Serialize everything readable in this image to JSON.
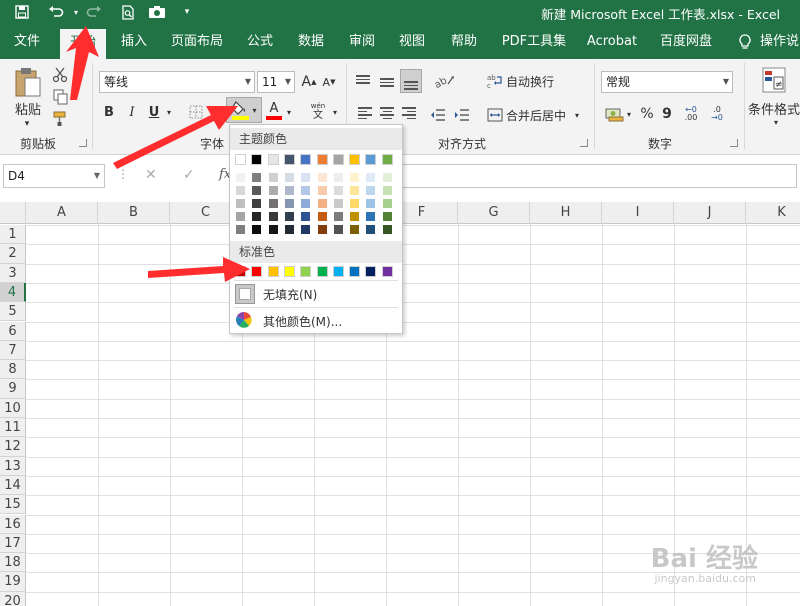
{
  "window": {
    "title": "新建 Microsoft Excel 工作表.xlsx  -  Excel"
  },
  "quick_access": [
    "save-icon",
    "undo-icon",
    "redo-icon",
    "print-preview-icon",
    "camera-icon",
    "customize-icon"
  ],
  "tabs": [
    {
      "label": "文件"
    },
    {
      "label": "开始"
    },
    {
      "label": "插入"
    },
    {
      "label": "页面布局"
    },
    {
      "label": "公式"
    },
    {
      "label": "数据"
    },
    {
      "label": "审阅"
    },
    {
      "label": "视图"
    },
    {
      "label": "帮助"
    },
    {
      "label": "PDF工具集"
    },
    {
      "label": "Acrobat"
    },
    {
      "label": "百度网盘"
    },
    {
      "label": "操作说"
    }
  ],
  "ribbon": {
    "clipboard": {
      "paste": "粘贴",
      "group": "剪贴板"
    },
    "font": {
      "name": "等线",
      "size": "11",
      "bold": "B",
      "italic": "I",
      "underline": "U",
      "font_color_letter": "A",
      "phonetic_top": "wén",
      "phonetic_bottom": "文",
      "grow": "A",
      "shrink": "A",
      "group": "字体"
    },
    "alignment": {
      "wrap": "自动换行",
      "merge": "合并后居中",
      "group": "对齐方式"
    },
    "number": {
      "format": "常规",
      "percent": "%",
      "comma": "9",
      "inc": ".00",
      "dec": ".0",
      "group": "数字"
    },
    "styles": {
      "conditional": "条件格式"
    }
  },
  "formula_bar": {
    "name_box": "D4",
    "cancel": "✕",
    "enter": "✓",
    "fx": "fx"
  },
  "columns": [
    "A",
    "B",
    "C",
    "D",
    "E",
    "F",
    "G",
    "H",
    "I",
    "J",
    "K"
  ],
  "rows": [
    "1",
    "2",
    "3",
    "4",
    "5",
    "6",
    "7",
    "8",
    "9",
    "10",
    "11",
    "12",
    "13",
    "14",
    "15",
    "16",
    "17",
    "18",
    "19",
    "20"
  ],
  "selected_row": "4",
  "color_picker": {
    "theme_title": "主题颜色",
    "standard_title": "标准色",
    "no_fill": "无填充(N)",
    "more_colors": "其他颜色(M)...",
    "theme_base": [
      "#FFFFFF",
      "#000000",
      "#E7E6E6",
      "#44546A",
      "#4472C4",
      "#ED7D31",
      "#A5A5A5",
      "#FFC000",
      "#5B9BD5",
      "#70AD47"
    ],
    "theme_shades": [
      [
        "#F2F2F2",
        "#7F7F7F",
        "#D0CECE",
        "#D6DCE4",
        "#D9E2F3",
        "#FBE5D5",
        "#EDEDED",
        "#FFF2CC",
        "#DEEBF6",
        "#E2EFD9"
      ],
      [
        "#D8D8D8",
        "#595959",
        "#AEABAB",
        "#ADB9CA",
        "#B4C6E7",
        "#F7CBAC",
        "#DBDBDB",
        "#FFE598",
        "#BDD7EE",
        "#C5E0B3"
      ],
      [
        "#BFBFBF",
        "#3F3F3F",
        "#757070",
        "#8496B0",
        "#8EAADB",
        "#F4B183",
        "#C9C9C9",
        "#FFD965",
        "#9CC3E5",
        "#A8D08D"
      ],
      [
        "#A5A5A5",
        "#262626",
        "#3A3838",
        "#323F4F",
        "#2F5496",
        "#C55A11",
        "#7B7B7B",
        "#BF9000",
        "#2E75B5",
        "#538135"
      ],
      [
        "#7F7F7F",
        "#0C0C0C",
        "#171616",
        "#222A35",
        "#1F3864",
        "#833C0B",
        "#525252",
        "#7F6000",
        "#1E4E79",
        "#375623"
      ]
    ],
    "standard": [
      "#C00000",
      "#FF0000",
      "#FFC000",
      "#FFFF00",
      "#92D050",
      "#00B050",
      "#00B0F0",
      "#0070C0",
      "#002060",
      "#7030A0"
    ]
  },
  "watermark": {
    "main": "Bai 经验",
    "sub": "jingyan.baidu.com"
  },
  "colors": {
    "excel_green": "#217346",
    "arrow_red": "#FF2D2D"
  }
}
